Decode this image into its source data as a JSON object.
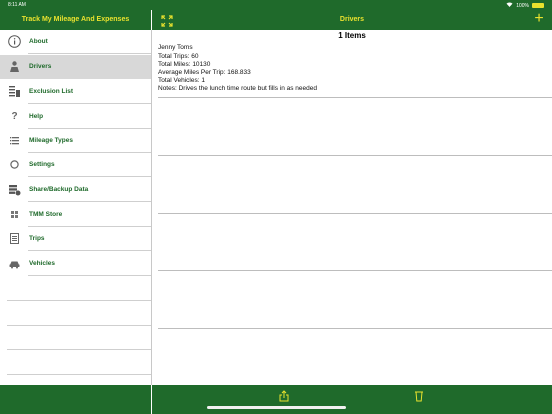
{
  "status_bar": {
    "time": "8:11 AM",
    "battery": "100%"
  },
  "sidebar": {
    "title": "Track My Mileage And Expenses",
    "items": [
      {
        "label": "About",
        "icon": "info-icon"
      },
      {
        "label": "Drivers",
        "icon": "driver-icon",
        "active": true
      },
      {
        "label": "Exclusion List",
        "icon": "exclusion-list-icon"
      },
      {
        "label": "Help",
        "icon": "question-icon"
      },
      {
        "label": "Mileage Types",
        "icon": "list-icon"
      },
      {
        "label": "Settings",
        "icon": "settings-icon"
      },
      {
        "label": "Share/Backup Data",
        "icon": "backup-icon"
      },
      {
        "label": "TMM Store",
        "icon": "store-icon"
      },
      {
        "label": "Trips",
        "icon": "trips-icon"
      },
      {
        "label": "Vehicles",
        "icon": "car-icon"
      }
    ]
  },
  "main": {
    "title": "Drivers",
    "count_label": "1 Items",
    "drivers": [
      {
        "name": "Jenny Toms",
        "total_trips": "Total Trips: 60",
        "total_miles": "Total Miles: 10130",
        "avg_miles": "Average Miles Per Trip: 168.833",
        "total_vehicles": "Total Vehicles: 1",
        "notes": "Notes: Drives the lunch time route but fills in as needed"
      }
    ]
  },
  "colors": {
    "bar": "#1f6a2b",
    "accent": "#e9e22e",
    "label": "#1f6a2b"
  }
}
